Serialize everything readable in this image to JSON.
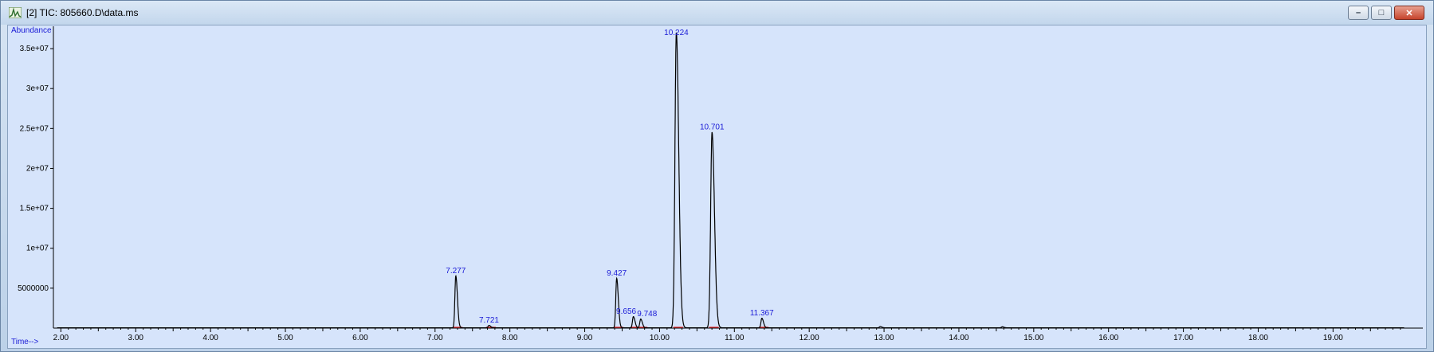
{
  "window": {
    "title": "[2] TIC: 805660.D\\data.ms",
    "buttons": {
      "minimize": "–",
      "maximize": "□",
      "close": "✕"
    }
  },
  "chart_data": {
    "type": "line",
    "ylabel": "Abundance",
    "xlabel": "Time-->",
    "xlim": [
      1.9,
      20.2
    ],
    "ylim": [
      0,
      37000000
    ],
    "x_ticks": [
      "2.00",
      "3.00",
      "4.00",
      "5.00",
      "6.00",
      "7.00",
      "8.00",
      "9.00",
      "10.00",
      "11.00",
      "12.00",
      "13.00",
      "14.00",
      "15.00",
      "16.00",
      "17.00",
      "18.00",
      "19.00"
    ],
    "y_ticks": [
      {
        "value": 5000000,
        "label": "5000000"
      },
      {
        "value": 10000000,
        "label": "1e+07"
      },
      {
        "value": 15000000,
        "label": "1.5e+07"
      },
      {
        "value": 20000000,
        "label": "2e+07"
      },
      {
        "value": 25000000,
        "label": "2.5e+07"
      },
      {
        "value": 30000000,
        "label": "3e+07"
      },
      {
        "value": 35000000,
        "label": "3.5e+07"
      }
    ],
    "series": [
      {
        "peaks": [
          {
            "rt": 7.277,
            "label": "7.277",
            "height": 6500000
          },
          {
            "rt": 7.721,
            "label": "7.721",
            "height": 300000
          },
          {
            "rt": 9.427,
            "label": "9.427",
            "height": 6200000
          },
          {
            "rt": 9.65,
            "label": "9.656",
            "height": 1400000
          },
          {
            "rt": 9.748,
            "label": "9.748",
            "height": 1100000
          },
          {
            "rt": 10.224,
            "label": "10.224",
            "height": 37000000
          },
          {
            "rt": 10.701,
            "label": "10.701",
            "height": 24500000
          },
          {
            "rt": 11.367,
            "label": "11.367",
            "height": 1200000
          },
          {
            "rt": 12.95,
            "label": "",
            "height": 150000
          },
          {
            "rt": 14.58,
            "label": "",
            "height": 120000
          }
        ]
      }
    ],
    "colors": {
      "trace": "#000000",
      "baseline": "#e02020",
      "labels": "#1a1ad6",
      "background": "#d6e4fb"
    }
  }
}
